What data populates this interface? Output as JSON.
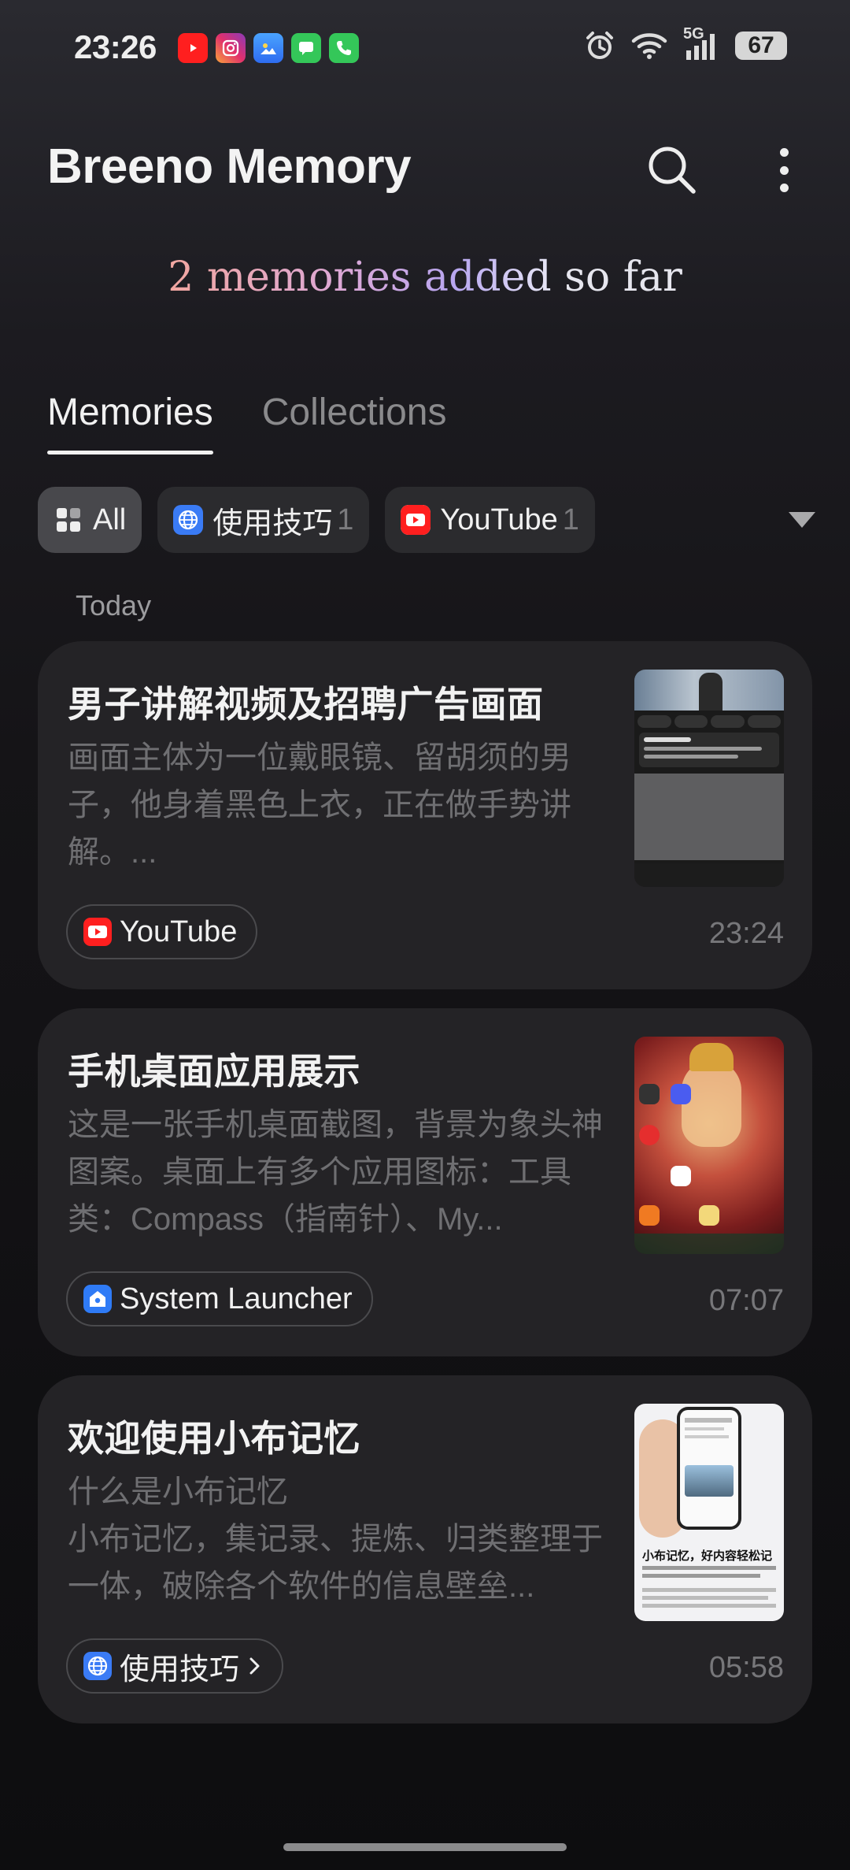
{
  "status_bar": {
    "time": "23:26",
    "notification_icons": [
      "youtube-icon",
      "instagram-icon",
      "gallery-icon",
      "messages-icon",
      "phone-icon"
    ],
    "network": "5G",
    "battery": "67"
  },
  "header": {
    "title": "Breeno Memory"
  },
  "summary": {
    "prefix": "2 memories added",
    "suffix": " so far"
  },
  "tabs": [
    {
      "label": "Memories",
      "active": true
    },
    {
      "label": "Collections",
      "active": false
    }
  ],
  "filters": [
    {
      "label": "All",
      "count": "",
      "icon": "grid-icon"
    },
    {
      "label": "使用技巧",
      "count": "1",
      "icon": "globe-icon"
    },
    {
      "label": "YouTube",
      "count": "1",
      "icon": "youtube-icon"
    }
  ],
  "section_label": "Today",
  "cards": [
    {
      "title": "男子讲解视频及招聘广告画面",
      "description": "画面主体为一位戴眼镜、留胡须的男子，他身着黑色上衣，正在做手势讲解。...",
      "source": "YouTube",
      "time": "23:24"
    },
    {
      "title": "手机桌面应用展示",
      "description": "这是一张手机桌面截图，背景为象头神图案。桌面上有多个应用图标：工具类：Compass（指南针）、My...",
      "source": "System Launcher",
      "time": "07:07"
    },
    {
      "title": "欢迎使用小布记忆",
      "description": "什么是小布记忆\n小布记忆，集记录、提炼、归类整理于一体，破除各个软件的信息壁垒...",
      "source": "使用技巧",
      "time": "05:58",
      "thumb_caption": "小布记忆，好内容轻松记"
    }
  ],
  "colors": {
    "youtube_red": "#ff1f1f",
    "globe_blue": "#3a7bf5",
    "launcher_blue": "#2f7bf6"
  }
}
